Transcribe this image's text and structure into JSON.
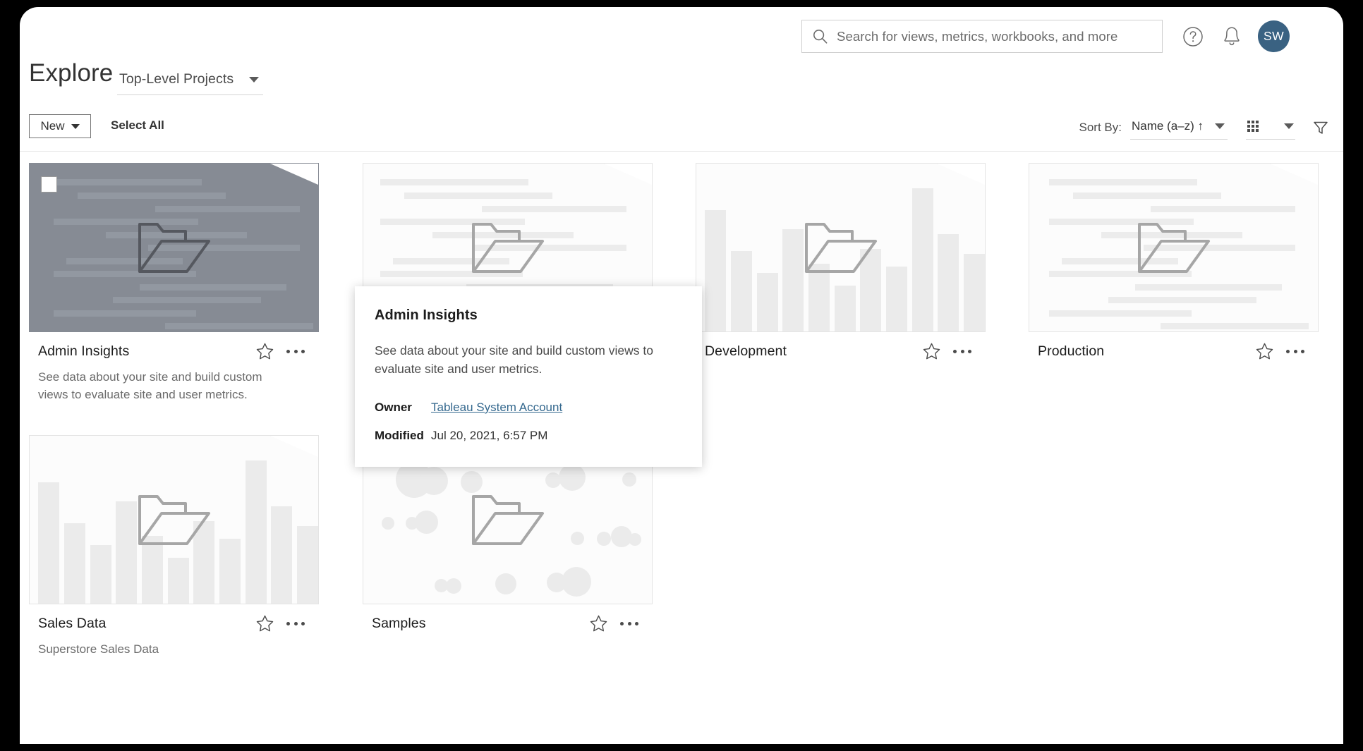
{
  "topbar": {
    "search_placeholder": "Search for views, metrics, workbooks, and more",
    "search_value": "",
    "help_icon": "question-circle-icon",
    "notifications_icon": "bell-icon",
    "avatar_initials": "SW",
    "avatar_color": "#3a6282"
  },
  "header": {
    "title": "Explore",
    "project_scope": "Top-Level Projects"
  },
  "toolbar": {
    "new_label": "New",
    "select_all_label": "Select All",
    "sort_by_label": "Sort By:",
    "sort_value": "Name (a–z) ↑",
    "view_mode": "grid-view-icon",
    "filter_icon": "filter-icon"
  },
  "cards": [
    {
      "name": "Admin Insights",
      "description": "See data about your site and build custom views to evaluate site and user metrics.",
      "thumb_style": "lines",
      "selected": true,
      "checkbox_checked": false
    },
    {
      "name": "",
      "description": "",
      "thumb_style": "lines",
      "selected": false,
      "checkbox_checked": false
    },
    {
      "name": "Development",
      "description": "",
      "thumb_style": "bars",
      "selected": false,
      "checkbox_checked": false
    },
    {
      "name": "Production",
      "description": "",
      "thumb_style": "lines",
      "selected": false,
      "checkbox_checked": false
    },
    {
      "name": "Sales Data",
      "description": "Superstore Sales Data",
      "thumb_style": "bars",
      "selected": false,
      "checkbox_checked": false
    },
    {
      "name": "Samples",
      "description": "",
      "thumb_style": "bubbles",
      "selected": false,
      "checkbox_checked": false
    }
  ],
  "tooltip": {
    "title": "Admin Insights",
    "description": "See data about your site and build custom views to evaluate site and user metrics.",
    "owner_key": "Owner",
    "owner_value": "Tableau System Account",
    "modified_key": "Modified",
    "modified_value": "Jul 20, 2021, 6:57 PM"
  },
  "icons": {
    "search": "search-icon",
    "star": "star-outline-icon",
    "more": "more-horizontal-icon",
    "folder": "folder-open-icon",
    "caret": "chevron-down-icon"
  }
}
